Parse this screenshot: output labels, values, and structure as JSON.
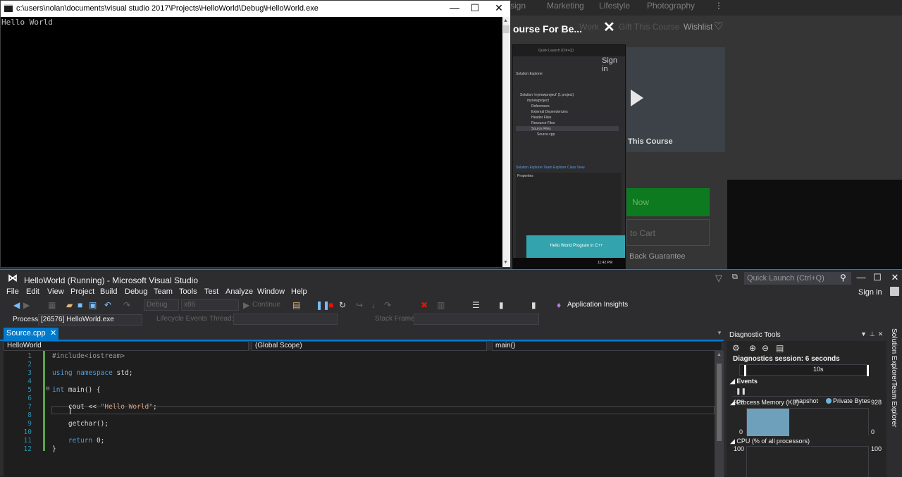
{
  "browser": {
    "nav_items": [
      "sign",
      "Marketing",
      "Lifestyle",
      "Photography"
    ],
    "course_title": "ourse For Be...",
    "links": [
      "Work",
      "Gift This Course"
    ],
    "wishlist": "Wishlist",
    "video_label": "This Course",
    "buy": "Now",
    "cart": "to Cart",
    "guarantee": "Back Guarantee"
  },
  "mini_vs": {
    "quick_launch": "Quick Launch (Ctrl+Q)",
    "sign_in": "Sign in",
    "solution_explorer": "Solution Explorer",
    "tree": [
      "Solution 'mynewproject' (1 project)",
      "mynewproject",
      "References",
      "External Dependencies",
      "Header Files",
      "Resource Files",
      "Source Files",
      "Source.cpp"
    ],
    "tabs": "Solution Explorer   Team Explorer   Class View",
    "properties": "Properties",
    "banner": "Hello World Program in C++",
    "time": "11:42 PM"
  },
  "console": {
    "title": "c:\\users\\nolan\\documents\\visual studio 2017\\Projects\\HelloWorld\\Debug\\HelloWorld.exe",
    "output": "Hello World"
  },
  "vs": {
    "title": "HelloWorld (Running) - Microsoft Visual Studio",
    "quick_launch": "Quick Launch (Ctrl+Q)",
    "sign_in": "Sign in",
    "menu": [
      "File",
      "Edit",
      "View",
      "Project",
      "Build",
      "Debug",
      "Team",
      "Tools",
      "Test",
      "Analyze",
      "Window",
      "Help"
    ],
    "toolbar": {
      "config": "Debug",
      "platform": "x86",
      "continue": "Continue",
      "app_insights": "Application Insights"
    },
    "process_label": "Process:",
    "process_value": "[26576] HelloWorld.exe",
    "lifecycle": "Lifecycle Events",
    "thread": "Thread:",
    "stack_frame": "Stack Frame:",
    "doc_tab": "Source.cpp",
    "nav": {
      "project": "HelloWorld",
      "scope": "(Global Scope)",
      "member": "main()"
    },
    "line_numbers": [
      "1",
      "2",
      "3",
      "4",
      "5",
      "6",
      "7",
      "8",
      "9",
      "10",
      "11",
      "12"
    ],
    "code": {
      "l1": "#include<iostream>",
      "l3_kw1": "using",
      "l3_kw2": "namespace",
      "l3_rest": " std;",
      "l5_kw": "int",
      "l5_rest": " main() {",
      "l7_pre": "    cout << ",
      "l7_str": "\"Hello World\"",
      "l7_post": ";",
      "l9": "    getchar();",
      "l11_kw": "return",
      "l11_rest": " 0;",
      "l12": "}"
    },
    "diagnostics": {
      "title": "Diagnostic Tools",
      "session": "Diagnostics session: 6 seconds",
      "timeline_label": "10s",
      "events": "Events",
      "memory": "Process Memory (KB)",
      "snapshot": "napshot",
      "private_bytes": "Private Bytes",
      "mem_max": "928",
      "mem_min": "0",
      "cpu": "CPU (% of all processors)",
      "cpu_max": "100"
    },
    "side_tabs": [
      "Solution Explorer",
      "Team Explorer"
    ]
  }
}
